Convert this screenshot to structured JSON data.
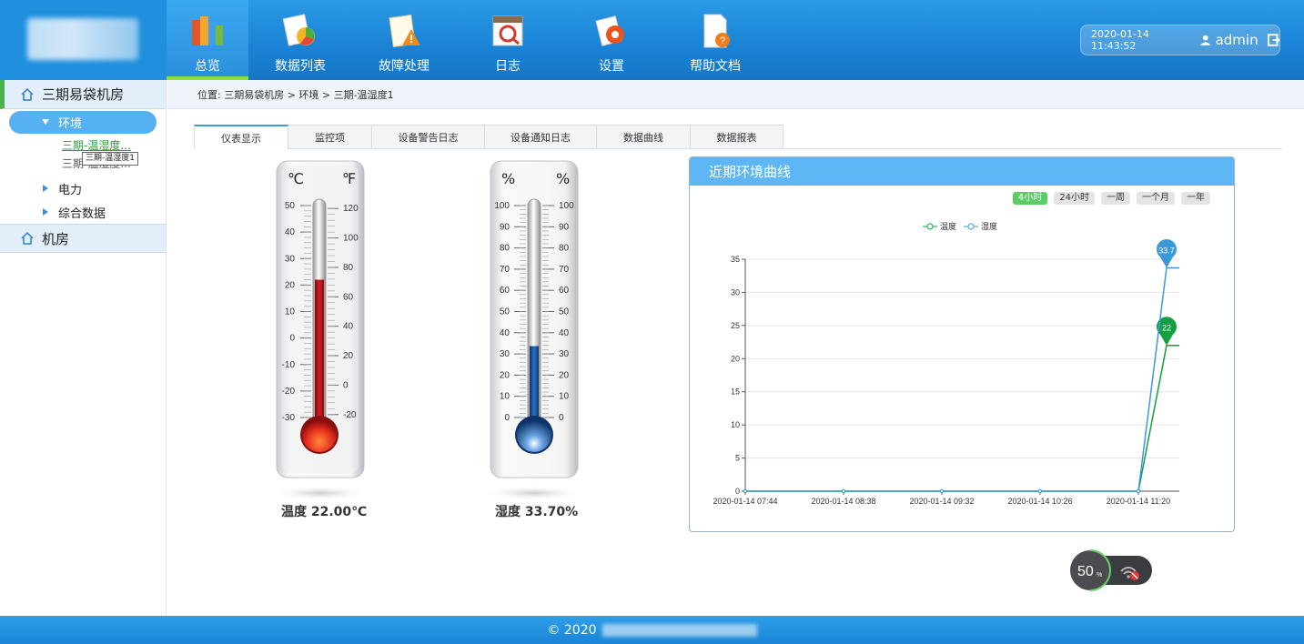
{
  "nav": {
    "items": [
      {
        "label": "总览",
        "icon": "books-icon"
      },
      {
        "label": "数据列表",
        "icon": "data-list-icon"
      },
      {
        "label": "故障处理",
        "icon": "warning-notepad-icon"
      },
      {
        "label": "日志",
        "icon": "calendar-search-icon"
      },
      {
        "label": "设置",
        "icon": "gear-icon"
      },
      {
        "label": "帮助文档",
        "icon": "help-document-icon"
      }
    ],
    "active_index": 0
  },
  "user": {
    "datetime": "2020-01-14  11:43:52",
    "name": "admin"
  },
  "sidebar": {
    "group1": "三期易袋机房",
    "env": "环境",
    "leaf1": "三期-温湿度...",
    "leaf2": "三期-温湿度...",
    "tooltip": "三期-温湿度1",
    "sub1": "电力",
    "sub2": "综合数据",
    "group2": "机房"
  },
  "breadcrumb": "位置:  三期易袋机房 > 环境 > 三期-温湿度1",
  "tabs": [
    "仪表显示",
    "监控项",
    "设备警告日志",
    "设备通知日志",
    "数据曲线",
    "数据报表"
  ],
  "temperature": {
    "unit_c": "℃",
    "unit_f": "℉",
    "c_ticks": [
      "50",
      "40",
      "30",
      "20",
      "10",
      "0",
      "-10",
      "-20",
      "-30"
    ],
    "f_ticks": [
      "120",
      "100",
      "80",
      "60",
      "40",
      "20",
      "0",
      "-20"
    ],
    "value": 22.0,
    "label": "温度  22.00℃",
    "color": "#c8141c"
  },
  "humidity": {
    "unit_l": "%",
    "unit_r": "%",
    "ticks": [
      "100",
      "90",
      "80",
      "70",
      "60",
      "50",
      "40",
      "30",
      "20",
      "10",
      "0"
    ],
    "value": 33.7,
    "label": "湿度  33.70%",
    "color": "#1e5fae"
  },
  "chart_panel": {
    "title": "近期环境曲线",
    "ranges": [
      "4小时",
      "24小时",
      "一周",
      "一个月",
      "一年"
    ],
    "active_range": 0,
    "legend": [
      "温度",
      "湿度"
    ]
  },
  "chart_data": {
    "type": "line",
    "x": [
      "2020-01-14 07:44",
      "2020-01-14 08:38",
      "2020-01-14 09:32",
      "2020-01-14 10:26",
      "2020-01-14 11:20",
      "2020-01-14 11:35",
      "2020-01-14 11:43"
    ],
    "xticks": [
      "2020-01-14 07:44",
      "2020-01-14 08:38",
      "2020-01-14 09:32",
      "2020-01-14 10:26",
      "2020-01-14 11:20"
    ],
    "series": [
      {
        "name": "温度",
        "color": "#13a040",
        "values": [
          0,
          0,
          0,
          0,
          0,
          22,
          22
        ],
        "marker_label": "22"
      },
      {
        "name": "湿度",
        "color": "#3a9ad9",
        "values": [
          0,
          0,
          0,
          0,
          0,
          33.7,
          33.7
        ],
        "marker_label": "33.7"
      }
    ],
    "ylim": [
      0,
      35
    ],
    "yticks": [
      "0",
      "5",
      "10",
      "15",
      "20",
      "25",
      "30",
      "35"
    ],
    "grid": true,
    "legend_position": "top"
  },
  "network_widget": {
    "percent": "50",
    "unit": "%"
  },
  "footer": {
    "text": "© 2020"
  }
}
